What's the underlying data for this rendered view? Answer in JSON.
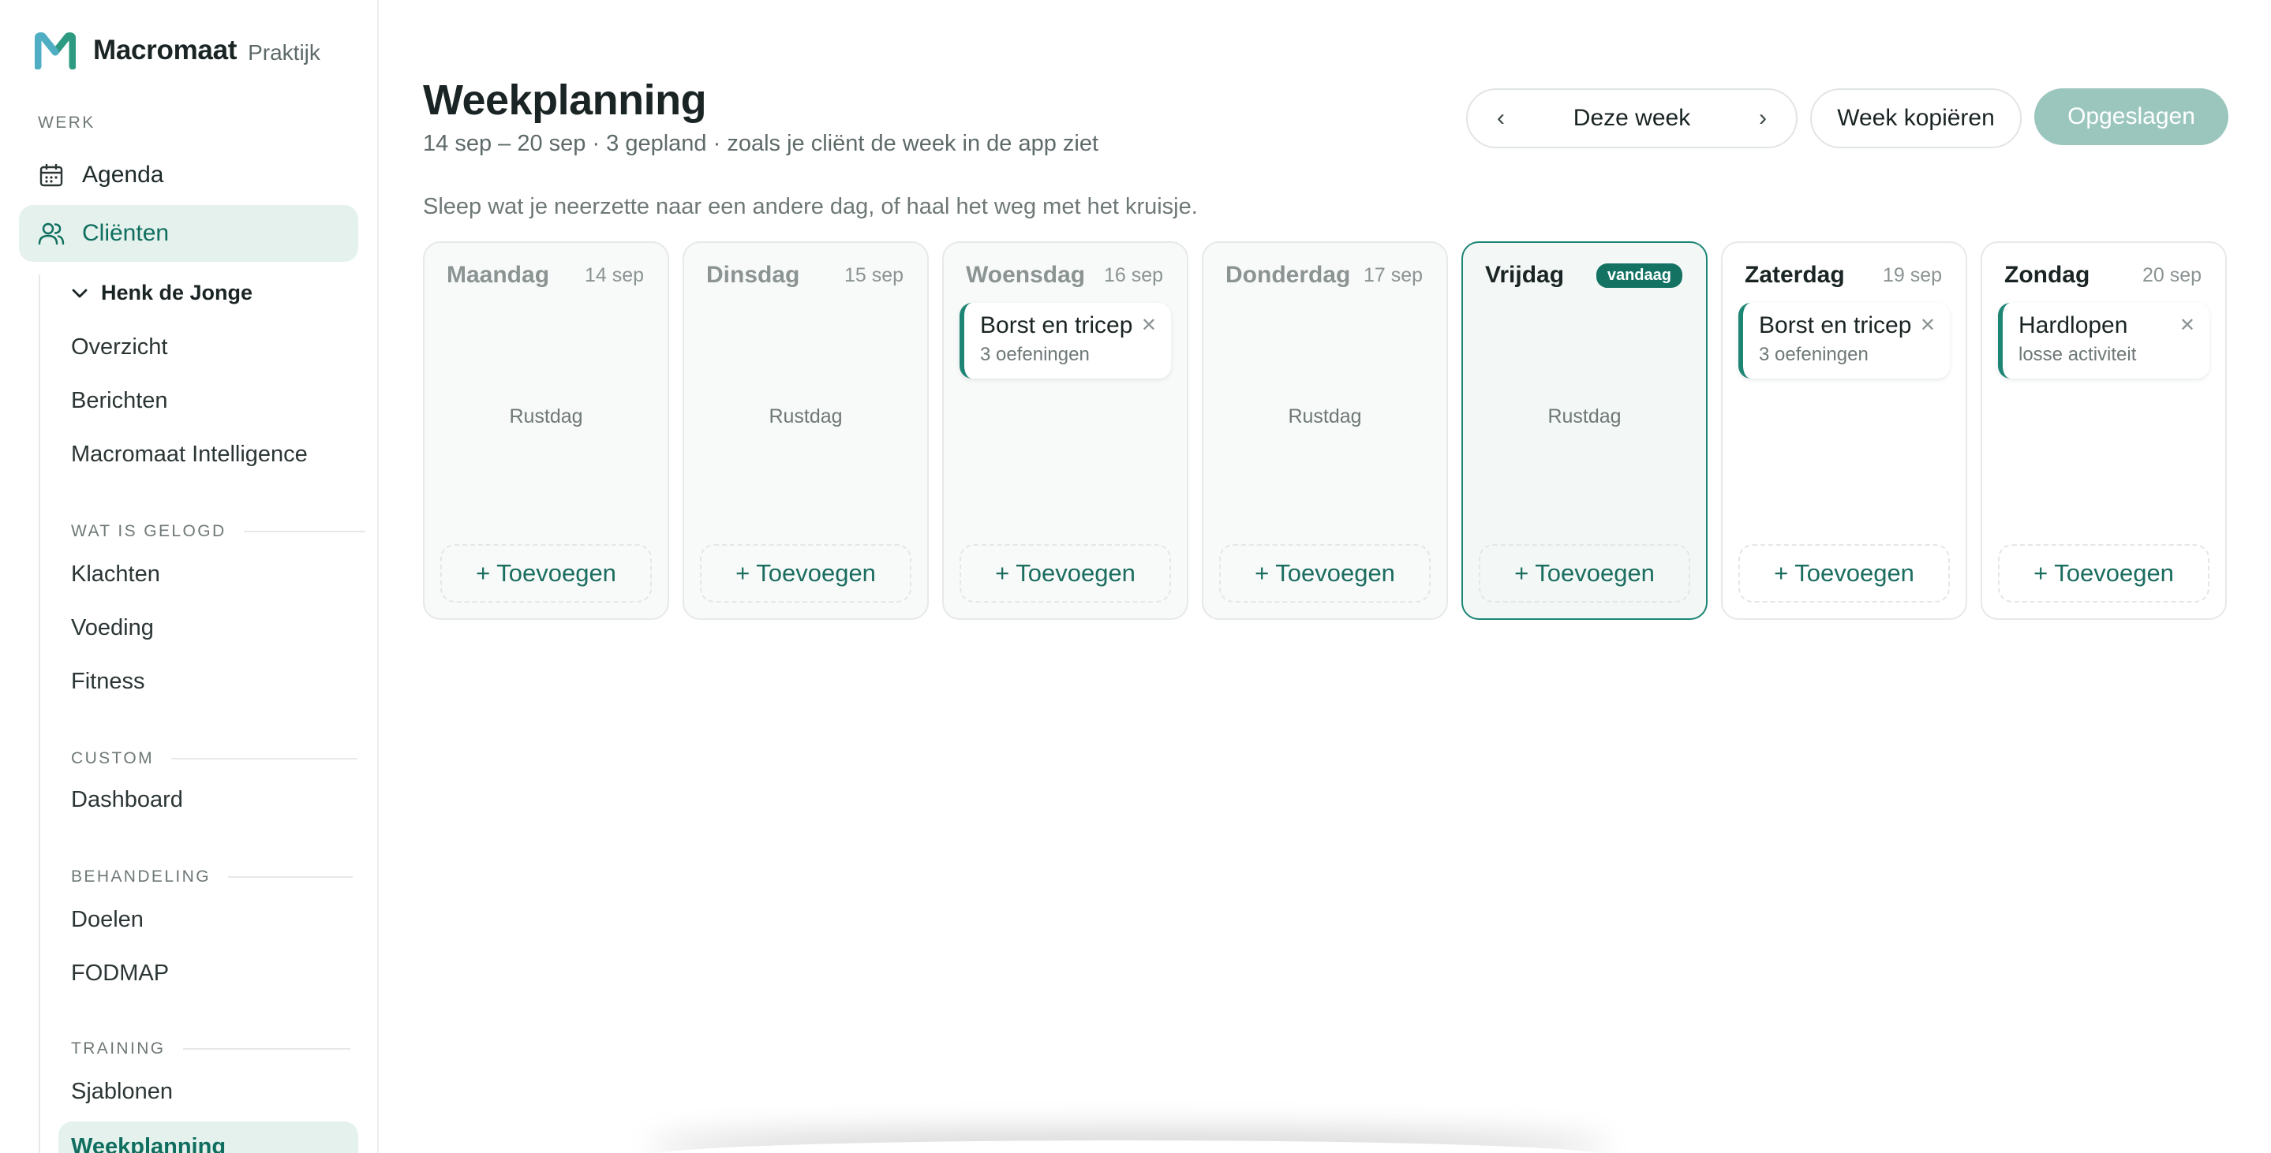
{
  "brand": {
    "name": "Macromaat",
    "sub": "Praktijk"
  },
  "sidebar": {
    "werk_label": "WERK",
    "nav": [
      {
        "label": "Agenda",
        "icon": "calendar-icon"
      },
      {
        "label": "Cliënten",
        "icon": "users-icon"
      }
    ],
    "client": {
      "name": "Henk de Jonge",
      "items": [
        "Overzicht",
        "Berichten",
        "Macromaat Intelligence"
      ]
    },
    "sections": [
      {
        "label": "WAT IS GELOGD",
        "items": [
          "Klachten",
          "Voeding",
          "Fitness"
        ]
      },
      {
        "label": "CUSTOM",
        "items": [
          "Dashboard"
        ]
      },
      {
        "label": "BEHANDELING",
        "items": [
          "Doelen",
          "FODMAP"
        ]
      },
      {
        "label": "TRAINING",
        "items": [
          "Sjablonen",
          "Weekplanning"
        ]
      }
    ]
  },
  "main": {
    "title": "Weekplanning",
    "subtitle": "14 sep – 20 sep · 3 gepland · zoals je cliënt de week in de app ziet",
    "hint": "Sleep wat je neerzette naar een andere dag, of haal het weg met het kruisje.",
    "week_nav": {
      "prev": "‹",
      "label": "Deze week",
      "next": "›"
    },
    "copy_button": "Week kopiëren",
    "save_button": "Opgeslagen",
    "rest_label": "Rustdag",
    "add_label": "+ Toevoegen",
    "today_badge": "vandaag",
    "days": [
      {
        "name": "Maandag",
        "date": "14 sep"
      },
      {
        "name": "Dinsdag",
        "date": "15 sep"
      },
      {
        "name": "Woensdag",
        "date": "16 sep",
        "workout": {
          "title": "Borst en tricep",
          "sub": "3 oefeningen"
        }
      },
      {
        "name": "Donderdag",
        "date": "17 sep"
      },
      {
        "name": "Vrijdag",
        "date": ""
      },
      {
        "name": "Zaterdag",
        "date": "19 sep",
        "workout": {
          "title": "Borst en tricep",
          "sub": "3 oefeningen"
        }
      },
      {
        "name": "Zondag",
        "date": "20 sep",
        "workout": {
          "title": "Hardlopen",
          "sub": "losse activiteit"
        }
      }
    ]
  },
  "colors": {
    "accent": "#1d8574",
    "accent_light": "#e4f1ec",
    "saved_button": "#9bc6bd",
    "badge": "#137262"
  }
}
